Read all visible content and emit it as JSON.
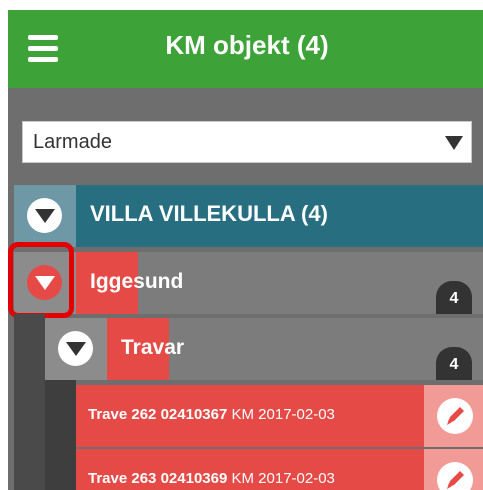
{
  "header": {
    "title": "KM objekt (4)"
  },
  "filter": {
    "selected": "Larmade"
  },
  "tree": {
    "villa": {
      "label": "VILLA VILLEKULLA (4)"
    },
    "iggesund": {
      "label": "Iggesund",
      "count": "4"
    },
    "travar": {
      "label": "Travar",
      "count": "4"
    },
    "items": [
      {
        "name": "Trave 262",
        "id": "02410367",
        "type": "KM",
        "date": "2017-02-03"
      },
      {
        "name": "Trave 263",
        "id": "02410369",
        "type": "KM",
        "date": "2017-02-03"
      }
    ]
  },
  "colors": {
    "header_green": "#3da237",
    "villa_teal": "#276f80",
    "alert_red": "#e54a46",
    "highlight_red": "#e50000"
  }
}
